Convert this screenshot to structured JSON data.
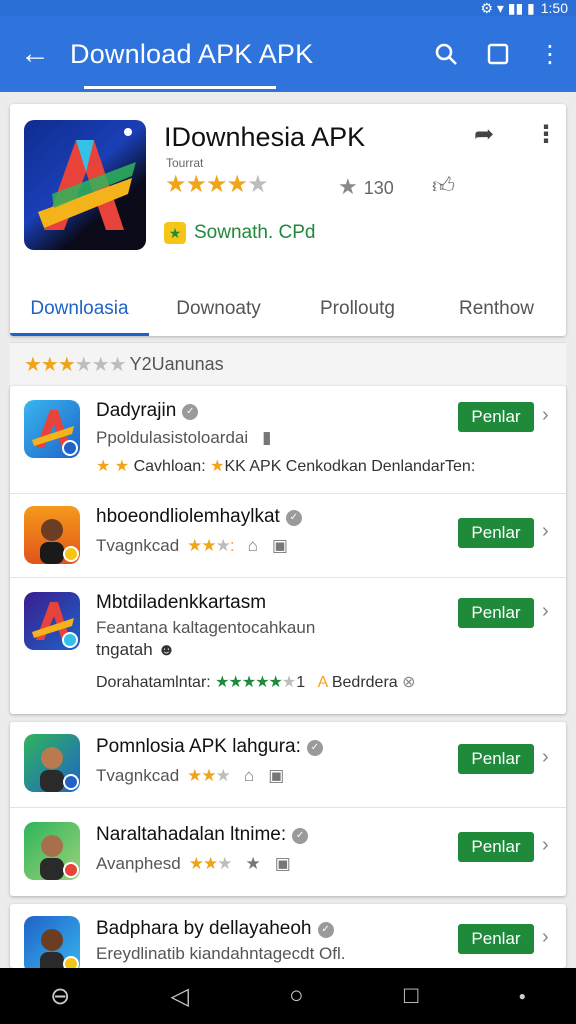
{
  "status": {
    "time": "1:50",
    "icons": "⚙ ▾ ▮▮ ▮"
  },
  "appbar": {
    "title": "Download APK  APK"
  },
  "hero": {
    "app_name": "IDownhesia APK",
    "developer": "Tourrat",
    "rating_count": "130",
    "badge_label": "Sownath. CPd",
    "tabs": [
      "Downloasia",
      "Downoaty",
      "Prolloutg",
      "Renthow"
    ]
  },
  "rating_summary": {
    "text": "Y2Uanunas"
  },
  "lists": [
    {
      "items": [
        {
          "name": "Dadyrajin",
          "sub": "Ppoldulasistoloardai",
          "meta_a": "Cavhloan:",
          "meta_b": "KK APK Cenkodkan DenlandarTen:",
          "button": "Penlar"
        },
        {
          "name": "hboeondliolemhaylkat",
          "sub": "Tvagnkcad",
          "button": "Penlar"
        },
        {
          "name": "Mbtdiladenkkartasm",
          "sub": "Feantana kaltagentocahkaun",
          "sub2": "tngatah",
          "meta_a": "Dorahatamlntar:",
          "meta_b": "1",
          "meta_c": "Bedrdera",
          "button": "Penlar"
        }
      ]
    },
    {
      "items": [
        {
          "name": "Pomnlosia APK lahgura:",
          "sub": "Tvagnkcad",
          "button": "Penlar"
        },
        {
          "name": "Naraltahadalan ltnime:",
          "sub": "Avanphesd",
          "button": "Penlar"
        }
      ]
    },
    {
      "items": [
        {
          "name": "Badphara by dellayaheoh",
          "sub": "Ereydlinatib kiandahntagecdt Ofl.",
          "button": "Penlar"
        }
      ]
    }
  ],
  "colors": {
    "appbar": "#2f74dc",
    "accent": "#1f63c7",
    "install": "#1e8a3a",
    "star": "#f0a41a"
  }
}
